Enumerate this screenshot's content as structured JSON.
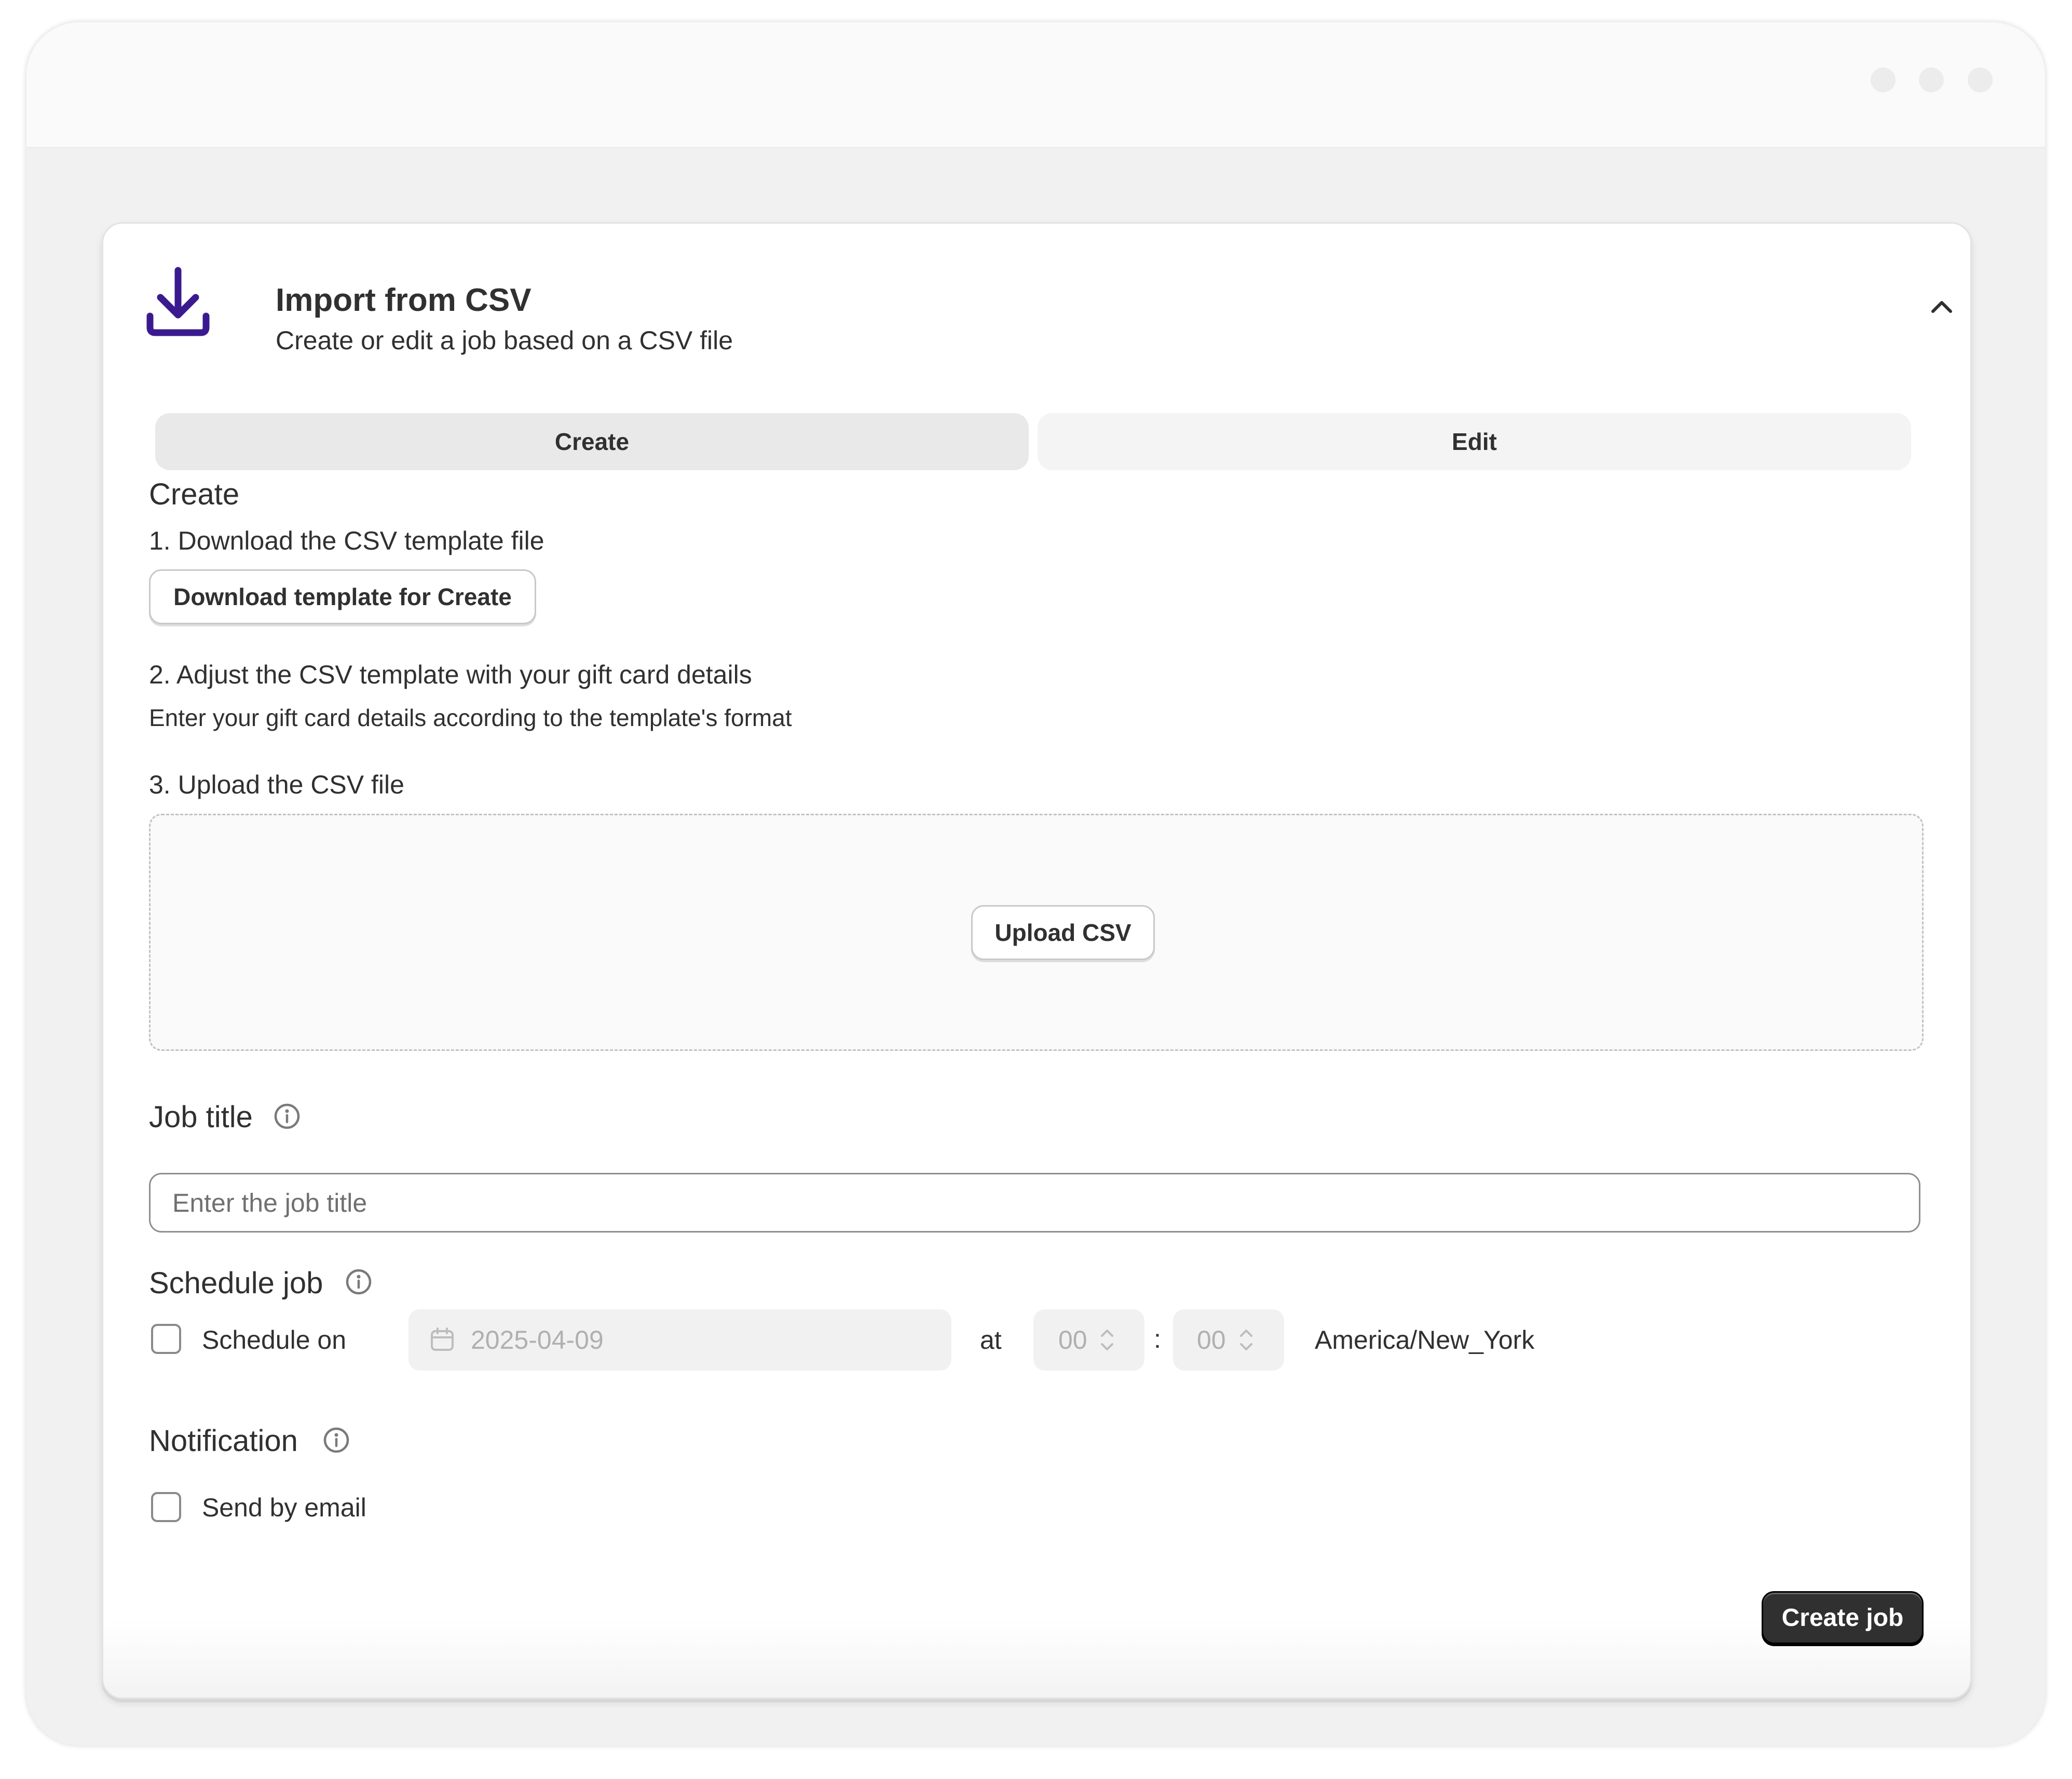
{
  "header": {
    "icon": "download-icon",
    "title": "Import from CSV",
    "subtitle": "Create or edit a job based on a CSV file",
    "collapse_icon": "chevron-up-icon"
  },
  "tabs": [
    {
      "label": "Create",
      "selected": true
    },
    {
      "label": "Edit",
      "selected": false
    }
  ],
  "section": {
    "heading": "Create",
    "step1_label": "1. Download the CSV template file",
    "download_button": "Download template for Create",
    "step2_label": "2. Adjust the CSV template with your gift card details",
    "step2_help": "Enter your gift card details according to the template's format",
    "step3_label": "3. Upload the CSV file",
    "upload_button": "Upload CSV"
  },
  "job_title": {
    "label": "Job title",
    "placeholder": "Enter the job title",
    "value": ""
  },
  "schedule": {
    "label": "Schedule job",
    "checkbox_label": "Schedule on",
    "checked": false,
    "date": "2025-04-09",
    "at_label": "at",
    "hour": "00",
    "separator": ":",
    "minute": "00",
    "timezone": "America/New_York"
  },
  "notification": {
    "label": "Notification",
    "checkbox_label": "Send by email",
    "checked": false
  },
  "footer": {
    "primary_button": "Create job"
  },
  "colors": {
    "accent": "#3b1a8f",
    "primary_button": "#303030",
    "text": "#303030",
    "disabled_text": "#b0b0b0"
  }
}
